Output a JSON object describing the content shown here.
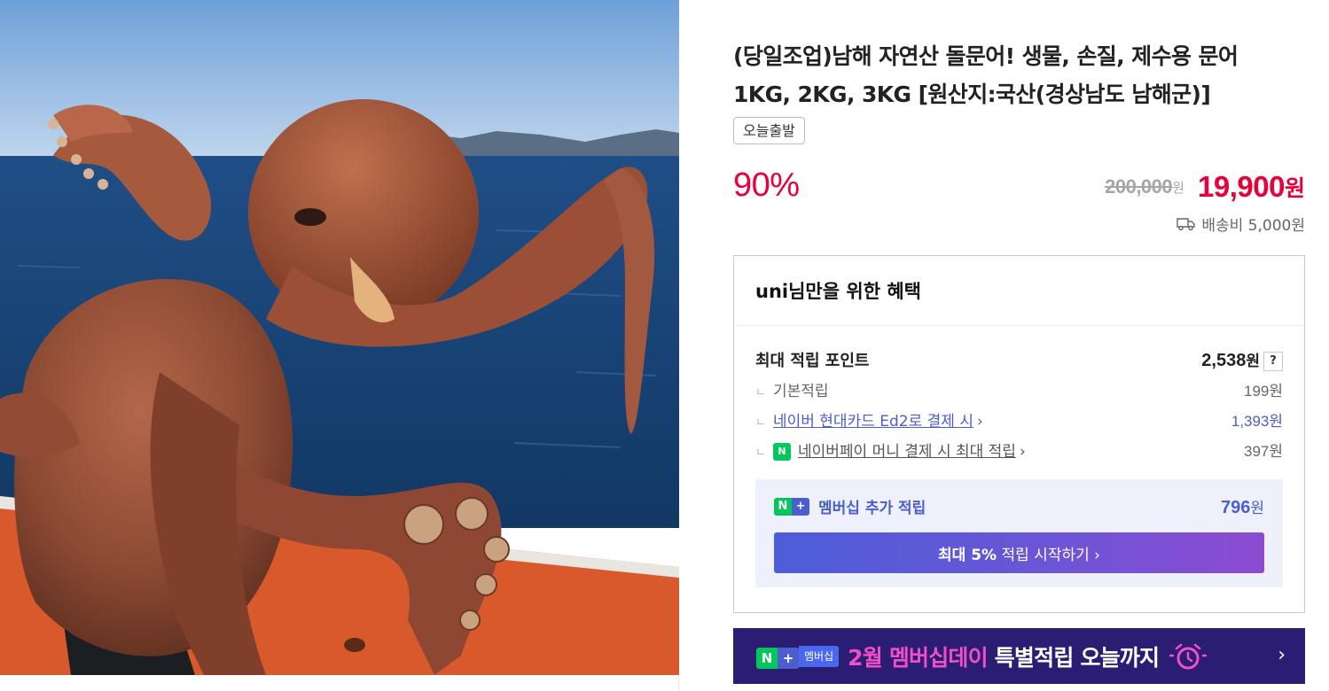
{
  "product": {
    "title": "(당일조업)남해 자연산 돌문어! 생물, 손질, 제수용 문어 1KG, 2KG, 3KG [원산지:국산(경상남도 남해군)]",
    "badge": "오늘출발",
    "discount": "90%",
    "original_price": "200,000",
    "original_unit": "원",
    "final_price": "19,900",
    "final_unit": "원",
    "shipping": "배송비 5,000원",
    "image_alt": "octopus-photo"
  },
  "benefit": {
    "heading": "uni님만을 위한 혜택",
    "max_points_label": "최대 적립 포인트",
    "max_points_value": "2,538",
    "max_points_unit": "원",
    "help": "?",
    "rows": [
      {
        "mark": "ㄴ",
        "label": "기본적립",
        "value": "199원"
      },
      {
        "mark": "ㄴ",
        "label": "네이버 현대카드 Ed2로 결제 시",
        "arrow": "›",
        "value": "1,393원"
      },
      {
        "mark": "ㄴ",
        "icon": "N",
        "label": "네이버페이 머니 결제 시 최대 적립",
        "arrow": "›",
        "value": "397원"
      }
    ],
    "membership": {
      "label": "멤버십 추가 적립",
      "value": "796",
      "unit": "원",
      "button_bold": "최대 5%",
      "button_text": "적립 시작하기 ›"
    }
  },
  "banner": {
    "tag": "멤버십",
    "pink_text": "2월 멤버십데이",
    "white_text": "특별적립 오늘까지",
    "arrow": "›"
  },
  "colors": {
    "accent_red": "#e8003a",
    "naver_green": "#03c75a",
    "member_blue": "#4c5dcd",
    "banner_bg": "#2b1d73"
  }
}
